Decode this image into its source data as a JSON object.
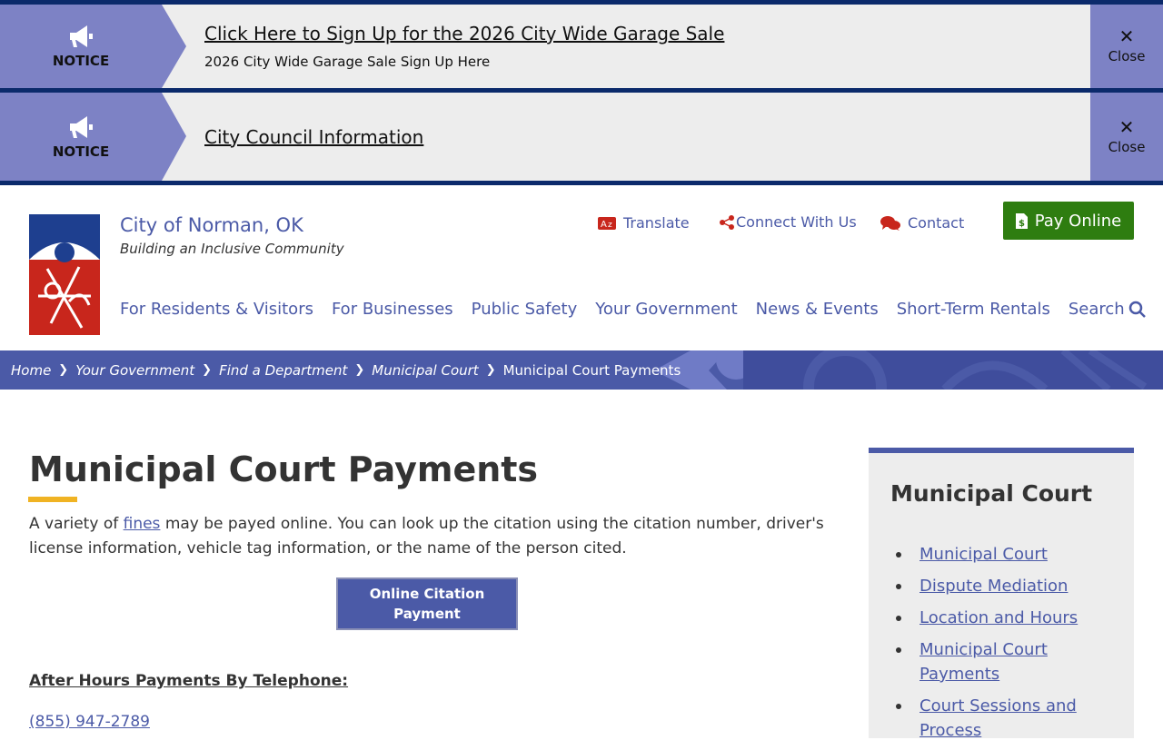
{
  "notices": [
    {
      "label": "NOTICE",
      "title": "Click Here to Sign Up for the 2026 City Wide Garage Sale",
      "subtitle": "2026 City Wide Garage Sale Sign Up Here",
      "close_label": "Close"
    },
    {
      "label": "NOTICE",
      "title": "City Council Information",
      "close_label": "Close"
    }
  ],
  "site": {
    "name": "City of Norman, OK",
    "tagline": "Building an Inclusive Community"
  },
  "utility": {
    "translate": "Translate",
    "connect": "Connect With Us",
    "contact": "Contact",
    "pay": "Pay Online"
  },
  "nav": {
    "items": [
      "For Residents & Visitors",
      "For Businesses",
      "Public Safety",
      "Your Government",
      "News & Events",
      "Short-Term Rentals"
    ],
    "search": "Search"
  },
  "breadcrumb": [
    "Home",
    "Your Government",
    "Find a Department",
    "Municipal Court",
    "Municipal Court Payments"
  ],
  "main": {
    "title": "Municipal Court Payments",
    "intro_before": "A variety of ",
    "intro_link": "fines",
    "intro_after": " may be payed online.  You can look up the citation using the citation number, driver's license information, vehicle tag information, or the name of the person cited.",
    "cta": "Online Citation Payment",
    "after_hours": "After Hours Payments By Telephone:",
    "phone": "(855) 947-2789"
  },
  "sidebar": {
    "title": "Municipal Court",
    "items": [
      "Municipal Court",
      "Dispute Mediation",
      "Location and Hours",
      "Municipal Court Payments",
      "Court Sessions and Process"
    ]
  },
  "colors": {
    "brand": "#4b5aa7",
    "notice_bar": "#0b2a6b",
    "pay": "#2e7d10",
    "accent": "#f0b323"
  }
}
